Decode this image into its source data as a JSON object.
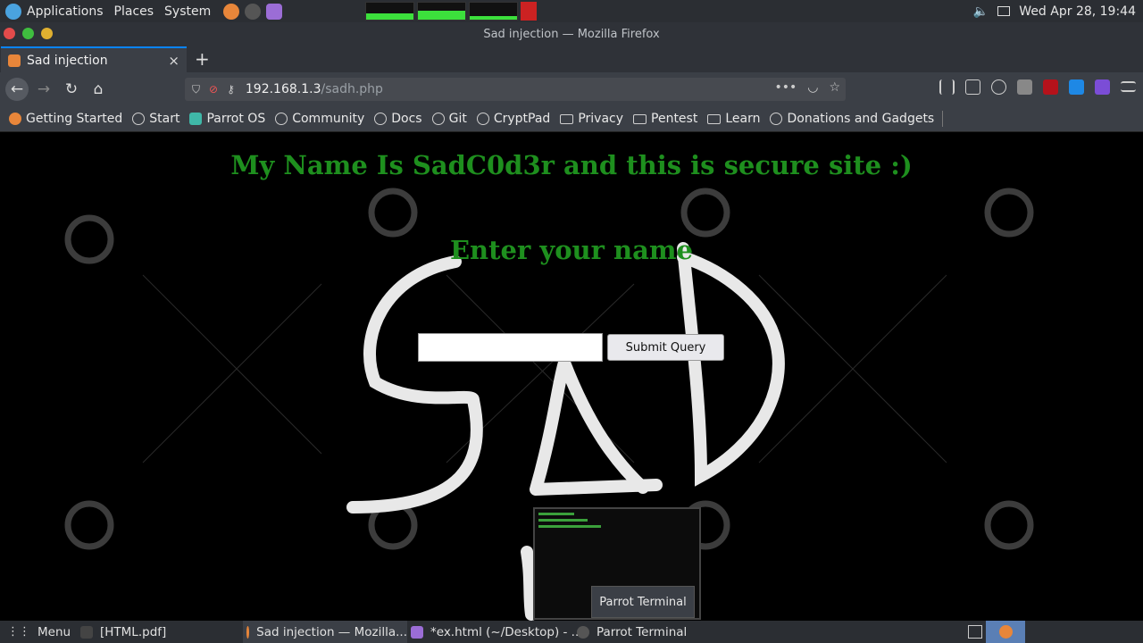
{
  "top_panel": {
    "applications": "Applications",
    "places": "Places",
    "system": "System",
    "datetime": "Wed Apr 28, 19:44",
    "graphs": [
      0.35,
      0.55,
      0.2
    ]
  },
  "window": {
    "title": "Sad injection — Mozilla Firefox"
  },
  "tab": {
    "title": "Sad injection",
    "close": "×",
    "new_tab": "+"
  },
  "nav": {
    "url_host": "192.168.1.3",
    "url_path": "/sadh.php"
  },
  "bookmarks": [
    {
      "label": "Getting Started",
      "icon": "firefox-icon"
    },
    {
      "label": "Start",
      "icon": "globe-icon"
    },
    {
      "label": "Parrot OS",
      "icon": "parrot-icon"
    },
    {
      "label": "Community",
      "icon": "globe-icon"
    },
    {
      "label": "Docs",
      "icon": "globe-icon"
    },
    {
      "label": "Git",
      "icon": "globe-icon"
    },
    {
      "label": "CryptPad",
      "icon": "globe-icon"
    },
    {
      "label": "Privacy",
      "icon": "folder-icon"
    },
    {
      "label": "Pentest",
      "icon": "folder-icon"
    },
    {
      "label": "Learn",
      "icon": "folder-icon"
    },
    {
      "label": "Donations and Gadgets",
      "icon": "globe-icon"
    }
  ],
  "page": {
    "heading": "My Name Is SadC0d3r and this is secure site :)",
    "prompt": "Enter your name",
    "input_value": "",
    "submit_label": "Submit Query",
    "tooltip": "Parrot Terminal",
    "heading_color": "#1e8f1e"
  },
  "taskbar": {
    "menu": "Menu",
    "items": [
      {
        "label": "[HTML.pdf]"
      },
      {
        "label": "Sad injection — Mozilla..."
      },
      {
        "label": "*ex.html (~/Desktop) - ..."
      },
      {
        "label": "Parrot Terminal"
      }
    ]
  }
}
